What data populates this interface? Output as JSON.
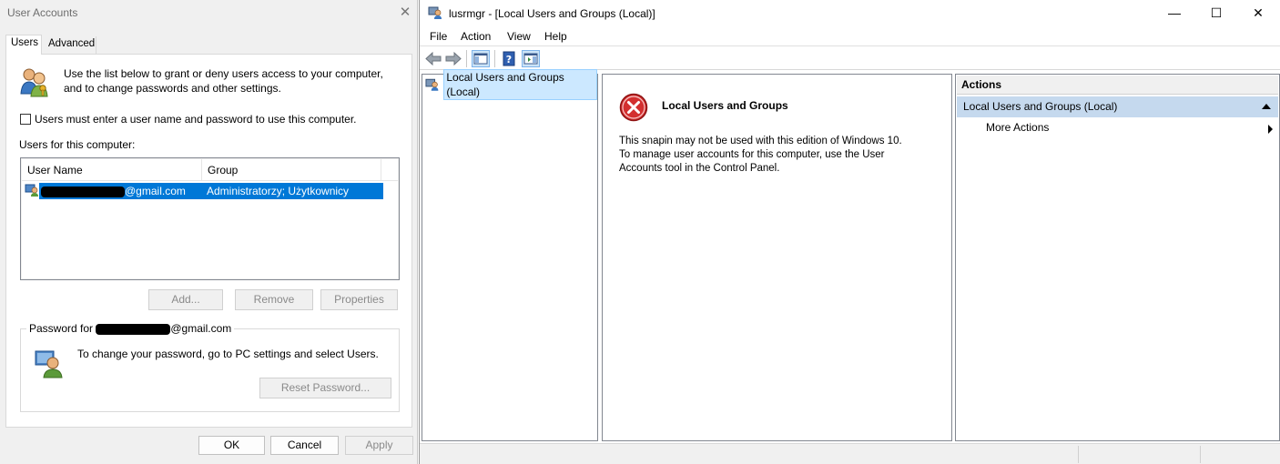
{
  "user_accounts": {
    "title": "User Accounts",
    "tabs": [
      {
        "label": "Users",
        "active": true
      },
      {
        "label": "Advanced",
        "active": false
      }
    ],
    "description": "Use the list below to grant or deny users access to your computer, and to change passwords and other settings.",
    "require_login_checkbox": {
      "label": "Users must enter a user name and password to use this computer.",
      "checked": false
    },
    "users_label": "Users for this computer:",
    "columns": [
      "User Name",
      "Group"
    ],
    "rows": [
      {
        "user_name_suffix": "@gmail.com",
        "group": "Administratorzy; Użytkownicy",
        "selected": true
      }
    ],
    "buttons": {
      "add": "Add...",
      "remove": "Remove",
      "properties": "Properties"
    },
    "password_group": {
      "legend_prefix": "Password for",
      "legend_suffix": "@gmail.com",
      "text": "To change your password, go to PC settings and select Users.",
      "reset_button": "Reset Password..."
    },
    "footer": {
      "ok": "OK",
      "cancel": "Cancel",
      "apply": "Apply"
    }
  },
  "mmc": {
    "title": "lusrmgr - [Local Users and Groups (Local)]",
    "menu": [
      "File",
      "Action",
      "View",
      "Help"
    ],
    "tree": {
      "item": "Local Users and Groups (Local)"
    },
    "center": {
      "title": "Local Users and Groups",
      "message_line1": "This snapin may not be used with this edition of Windows 10.",
      "message_line2": "To manage user accounts for this computer, use the User",
      "message_line3": "Accounts tool in the Control Panel."
    },
    "actions": {
      "header": "Actions",
      "section": "Local Users and Groups (Local)",
      "item": "More Actions"
    },
    "colors": {
      "selection": "#0078d7",
      "actions_section": "#c5d9ee",
      "error_red": "#d32f2f"
    }
  }
}
